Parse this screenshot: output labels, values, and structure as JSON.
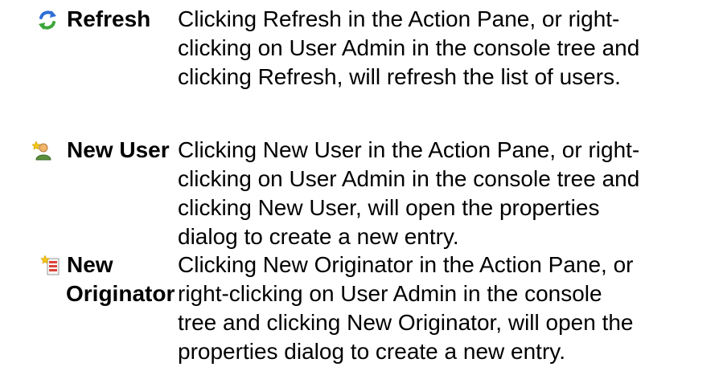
{
  "entries": [
    {
      "icon": "refresh-icon",
      "term_lines": [
        "Refresh"
      ],
      "desc_lines": [
        "Clicking Refresh in the Action Pane, or right-",
        "clicking on User Admin in the console tree and",
        "clicking Refresh, will refresh the list of users."
      ]
    },
    {
      "icon": "new-user-icon",
      "term_lines": [
        "New User"
      ],
      "desc_lines": [
        "Clicking New User in the Action Pane, or right-",
        "clicking on User Admin in the console tree and",
        "clicking New User, will open the properties",
        "dialog to create a new entry."
      ]
    },
    {
      "icon": "new-originator-icon",
      "term_lines": [
        "New",
        "Originator"
      ],
      "desc_lines": [
        "Clicking New Originator in the Action Pane, or",
        "right-clicking on User Admin in the console",
        "tree and clicking New Originator, will open the",
        "properties dialog to create a new entry."
      ]
    }
  ],
  "colors": {
    "refresh_blue": "#2f6fd6",
    "refresh_green": "#3aa63a",
    "user_skin": "#f2b56b",
    "user_shirt": "#5a8f3c",
    "star_yellow": "#f5c518",
    "doc_red": "#e0433a"
  }
}
